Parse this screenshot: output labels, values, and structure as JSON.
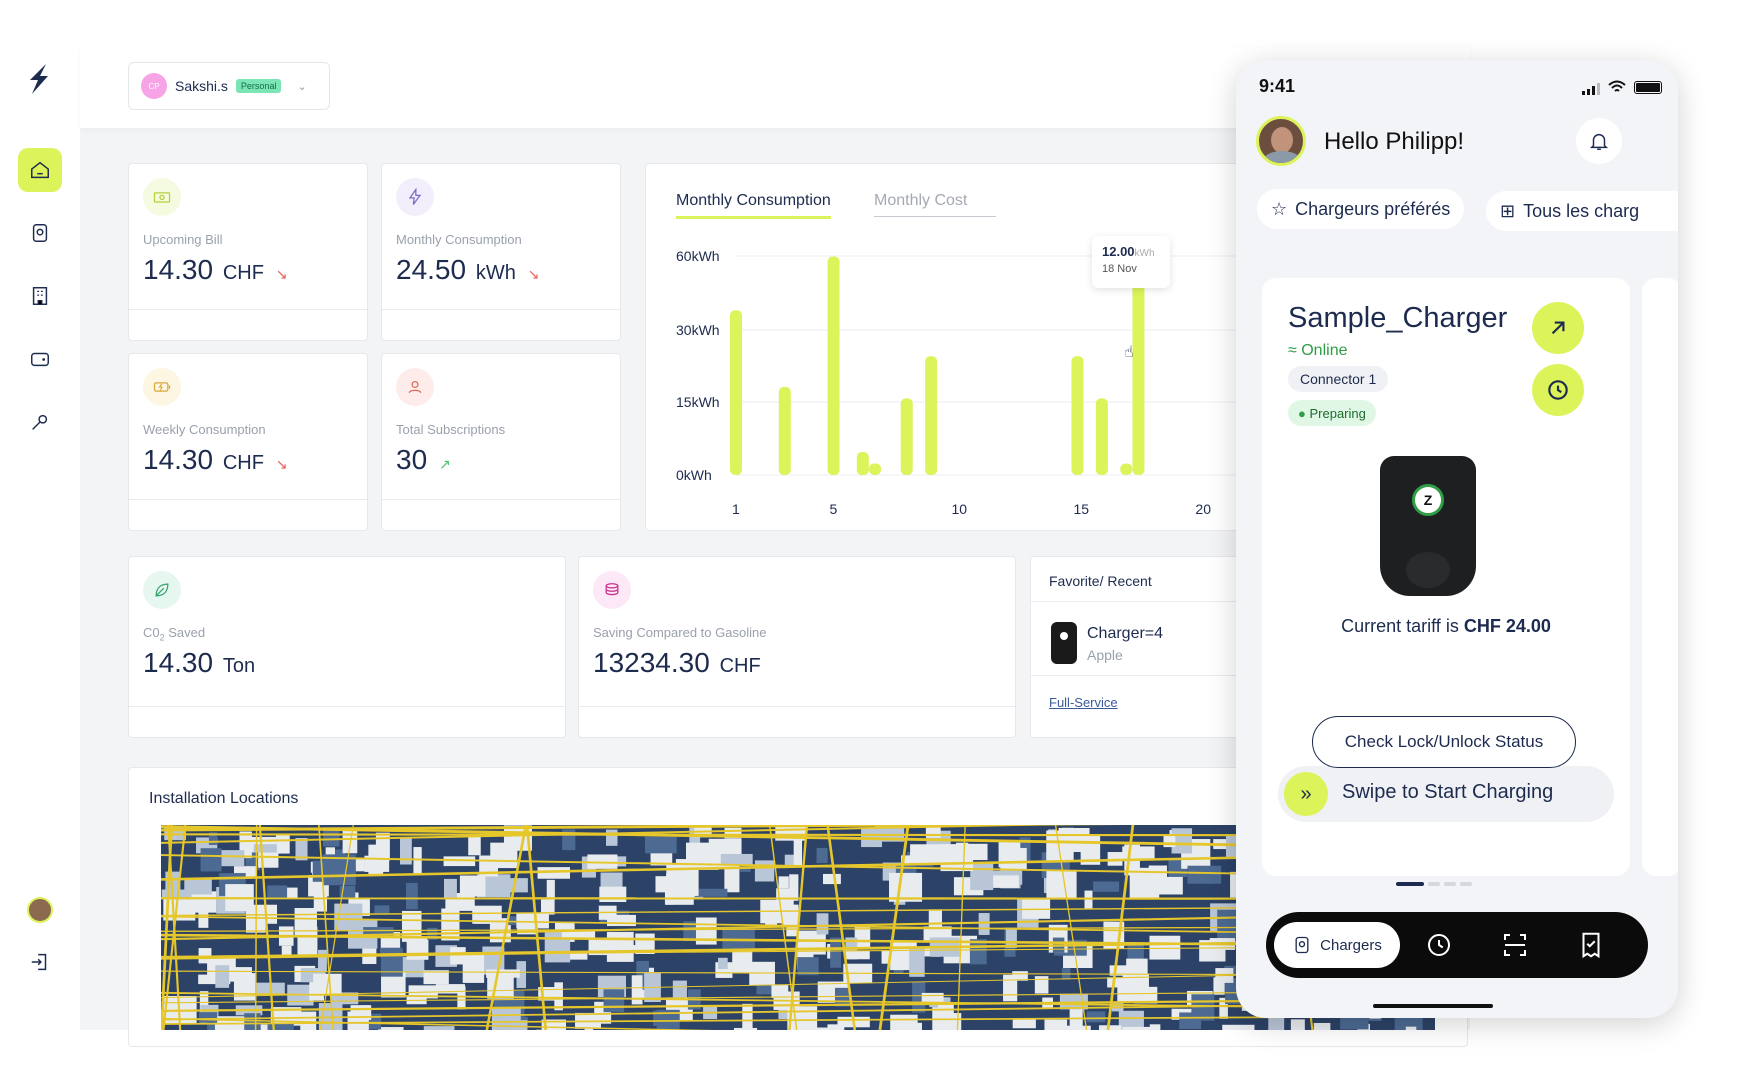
{
  "account": {
    "initials": "CP",
    "name": "Sakshi.s",
    "badge": "Personal"
  },
  "stats": {
    "upcoming_bill": {
      "label": "Upcoming Bill",
      "value": "14.30",
      "unit": "CHF",
      "trend": "down"
    },
    "monthly_consumption": {
      "label": "Monthly Consumption",
      "value": "24.50",
      "unit": "kWh",
      "trend": "down"
    },
    "weekly_consumption": {
      "label": "Weekly Consumption",
      "value": "14.30",
      "unit": "CHF",
      "trend": "down"
    },
    "total_subscriptions": {
      "label": "Total Subscriptions",
      "value": "30",
      "trend": "up"
    },
    "co2_saved": {
      "label_prefix": "C0",
      "label_sub": "2",
      "label_suffix": " Saved",
      "value": "14.30",
      "unit": "Ton"
    },
    "saving_gasoline": {
      "label": "Saving Compared to Gasoline",
      "value": "13234.30",
      "unit": "CHF"
    }
  },
  "chart": {
    "tabs": [
      "Monthly Consumption",
      "Monthly Cost"
    ],
    "tooltip": {
      "value": "12.00",
      "unit": "kWh",
      "date": "18 Nov"
    }
  },
  "chart_data": {
    "type": "bar",
    "x_ticks": [
      1,
      5,
      10,
      15,
      20
    ],
    "y_ticks": [
      "60kWh",
      "30kWh",
      "15kWh",
      "0kWh"
    ],
    "series": [
      {
        "values": [
          {
            "x": 1,
            "y": 43
          },
          {
            "x": 3,
            "y": 23
          },
          {
            "x": 5,
            "y": 57
          },
          {
            "x": 6.2,
            "y": 6
          },
          {
            "x": 6.7,
            "y": 3
          },
          {
            "x": 8,
            "y": 20
          },
          {
            "x": 9,
            "y": 31
          },
          {
            "x": 15,
            "y": 31
          },
          {
            "x": 16,
            "y": 20
          },
          {
            "x": 17,
            "y": 3
          },
          {
            "x": 17.5,
            "y": 50
          }
        ]
      }
    ],
    "highlighted": {
      "x": 17.5,
      "label": "12.00kWh",
      "date": "18 Nov"
    }
  },
  "favorites": {
    "title": "Favorite/ Recent",
    "item_name": "Charger=4",
    "item_sub": "Apple",
    "link": "Full-Service"
  },
  "map": {
    "title": "Installation Locations"
  },
  "phone": {
    "time": "9:41",
    "greeting": "Hello Philipp!",
    "chip_favorites": "Chargeurs préférés",
    "chip_all": "Tous les charg",
    "charger_name": "Sample_Charger",
    "status": "Online",
    "connector": "Connector 1",
    "state": "Preparing",
    "logo_letter": "Z",
    "tariff_prefix": "Current tariff is ",
    "tariff_value": "CHF 24.00",
    "swipe_label": "Swipe to Start Charging",
    "check_label": "Check Lock/Unlock Status",
    "nav_active": "Chargers"
  },
  "colors": {
    "accent": "#dcf35a",
    "navy": "#1d2b4f",
    "online": "#2f9e44"
  }
}
